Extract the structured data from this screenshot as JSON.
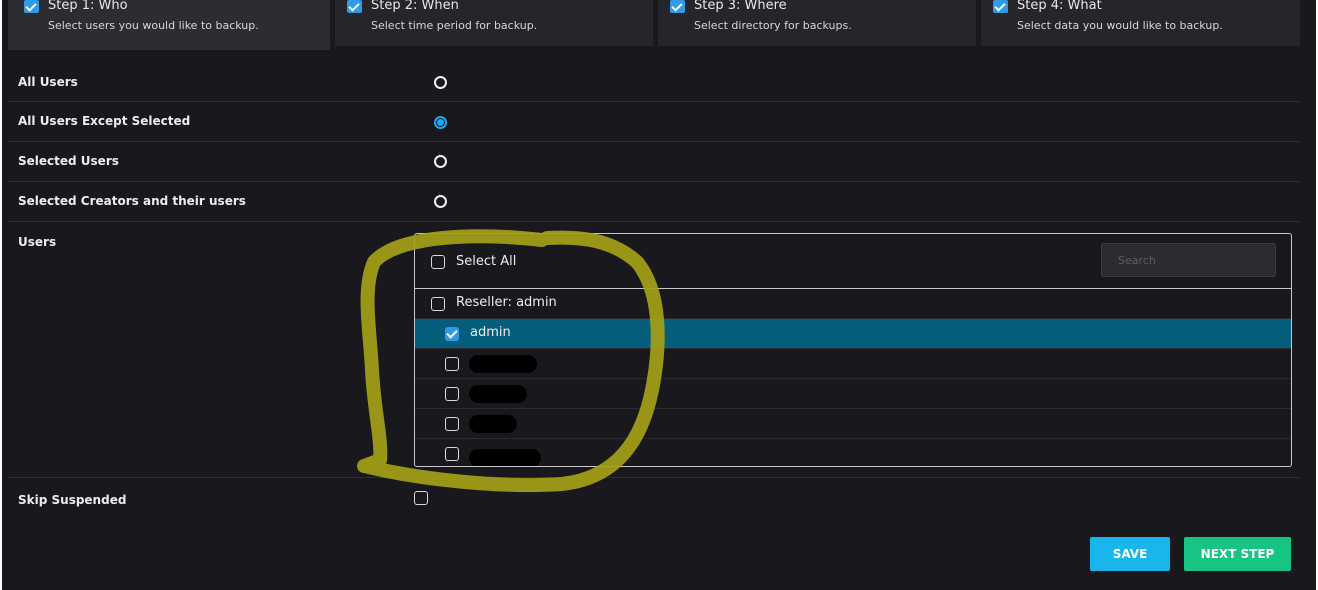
{
  "steps": [
    {
      "title": "Step 1: Who",
      "subtitle": "Select users you would like to backup.",
      "checked": true,
      "active": true
    },
    {
      "title": "Step 2: When",
      "subtitle": "Select time period for backup.",
      "checked": true,
      "active": false
    },
    {
      "title": "Step 3: Where",
      "subtitle": "Select directory for backups.",
      "checked": true,
      "active": false
    },
    {
      "title": "Step 4: What",
      "subtitle": "Select data you would like to backup.",
      "checked": true,
      "active": false
    }
  ],
  "options": [
    {
      "label": "All Users",
      "selected": false
    },
    {
      "label": "All Users Except Selected",
      "selected": true
    },
    {
      "label": "Selected Users",
      "selected": false
    },
    {
      "label": "Selected Creators and their users",
      "selected": false
    }
  ],
  "users_section": {
    "label": "Users",
    "select_all_label": "Select All",
    "search_placeholder": "Search",
    "items": [
      {
        "label": "Reseller: admin",
        "checked": false
      },
      {
        "label": "admin",
        "checked": true,
        "highlighted": true
      },
      {
        "label": "",
        "checked": false,
        "redacted": true
      },
      {
        "label": "",
        "checked": false,
        "redacted": true
      },
      {
        "label": "",
        "checked": false,
        "redacted": true
      },
      {
        "label": "",
        "checked": false,
        "redacted": true
      }
    ]
  },
  "skip_suspended": {
    "label": "Skip Suspended",
    "checked": false
  },
  "buttons": {
    "save": "SAVE",
    "next": "NEXT STEP"
  },
  "colors": {
    "background": "#19191d",
    "accent": "#1da8f5",
    "highlight_row": "#045e7c",
    "save_button": "#18b6ec",
    "next_button": "#17c483",
    "annotation": "#a4a016"
  }
}
